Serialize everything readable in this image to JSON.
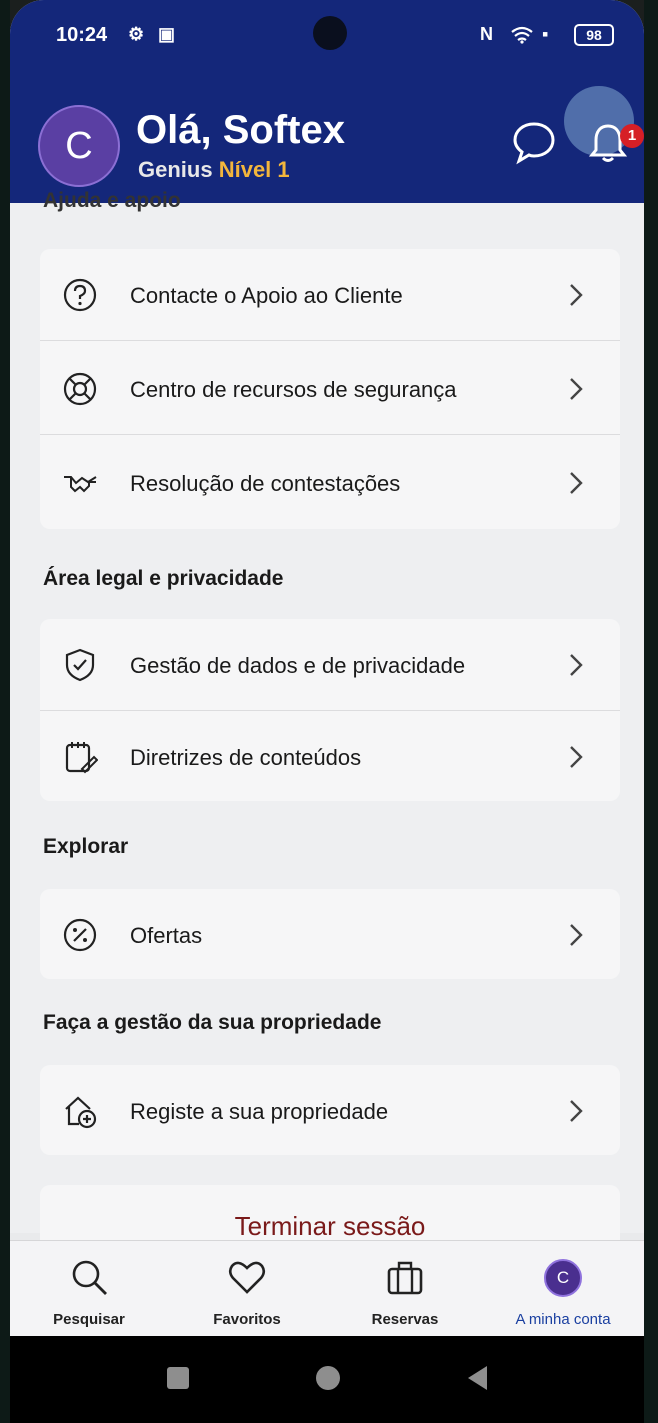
{
  "status_bar": {
    "time": "10:24",
    "battery": "98"
  },
  "header": {
    "avatar_initial": "C",
    "greeting": "Olá, Softex",
    "genius_label": "Genius",
    "level_label": "Nível 1",
    "notification_count": "1"
  },
  "sections": {
    "help": {
      "title": "Ajuda e apoio",
      "items": [
        {
          "label": "Contacte o Apoio ao Cliente",
          "icon": "question-icon"
        },
        {
          "label": "Centro de recursos de segurança",
          "icon": "lifebuoy-icon"
        },
        {
          "label": "Resolução de contestações",
          "icon": "handshake-icon"
        }
      ]
    },
    "legal": {
      "title": "Área legal e privacidade",
      "items": [
        {
          "label": "Gestão de dados e de privacidade",
          "icon": "shield-check-icon"
        },
        {
          "label": "Diretrizes de conteúdos",
          "icon": "notepad-icon"
        }
      ]
    },
    "explore": {
      "title": "Explorar",
      "items": [
        {
          "label": "Ofertas",
          "icon": "percent-icon"
        }
      ]
    },
    "property": {
      "title": "Faça a gestão da sua propriedade",
      "items": [
        {
          "label": "Registe a sua propriedade",
          "icon": "house-add-icon"
        }
      ]
    }
  },
  "logout_label": "Terminar sessão",
  "tabbar": {
    "search": "Pesquisar",
    "favorites": "Favoritos",
    "bookings": "Reservas",
    "account": "A minha conta",
    "account_initial": "C"
  },
  "colors": {
    "brand": "#14277a",
    "accent": "#f3b63c",
    "active_tab": "#1a3fa0",
    "logout": "#7a1a1a"
  }
}
